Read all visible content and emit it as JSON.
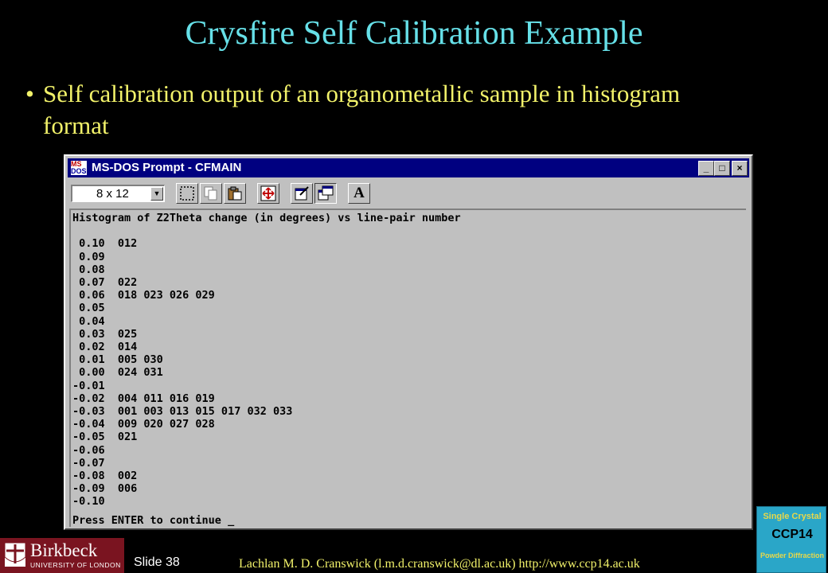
{
  "slide": {
    "title": "Crysfire Self Calibration Example",
    "bullet": "Self calibration output of an organometallic sample in histogram format",
    "slide_number": "Slide 38",
    "footer": "Lachlan M. D. Cranswick (l.m.d.cranswick@dl.ac.uk) http://www.ccp14.ac.uk"
  },
  "window": {
    "title": "MS-DOS Prompt - CFMAIN",
    "icon_text_top": "MS",
    "icon_text_bottom": "DOS",
    "minimize_label": "_",
    "maximize_label": "□",
    "close_label": "×",
    "font_size_value": "8 x 12",
    "toolbar_font_button": "A"
  },
  "console": {
    "lines": [
      "Histogram of Z2Theta change (in degrees) vs line-pair number",
      "",
      " 0.10  012",
      " 0.09",
      " 0.08",
      " 0.07  022",
      " 0.06  018 023 026 029",
      " 0.05",
      " 0.04",
      " 0.03  025",
      " 0.02  014",
      " 0.01  005 030",
      " 0.00  024 031",
      "-0.01",
      "-0.02  004 011 016 019",
      "-0.03  001 003 013 015 017 032 033",
      "-0.04  009 020 027 028",
      "-0.05  021",
      "-0.06",
      "-0.07",
      "-0.08  002",
      "-0.09  006",
      "-0.10"
    ],
    "prompt": "Press ENTER to continue _"
  },
  "logos": {
    "birkbeck_name": "Birkbeck",
    "birkbeck_sub": "UNIVERSITY OF LONDON",
    "ccp14_line1": "Single Crystal",
    "ccp14_line2": "CCP14",
    "ccp14_line3": "Powder Diffraction"
  },
  "colors": {
    "title": "#66e0e8",
    "bullet": "#f2f26a",
    "window_title_bar": "#000080",
    "console_bg": "#c0c0c0"
  }
}
